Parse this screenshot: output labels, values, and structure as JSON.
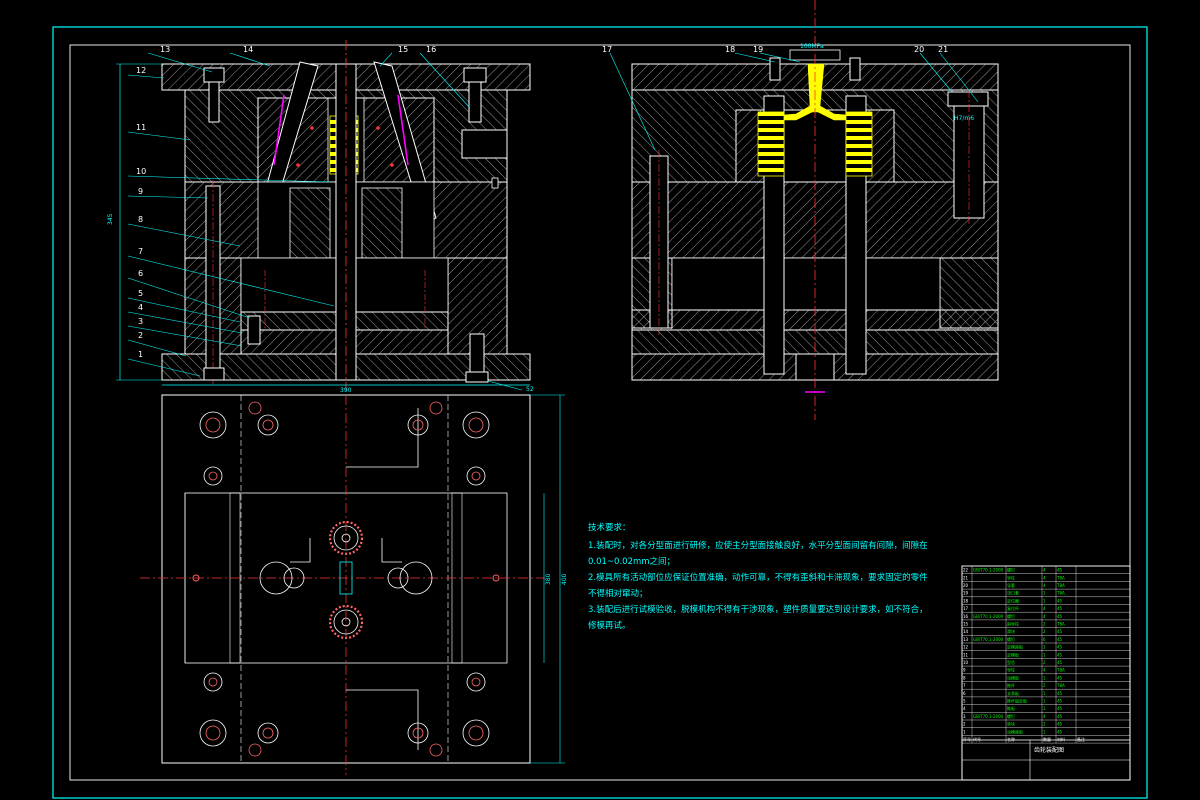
{
  "colors": {
    "background": "#000000",
    "frame": "#00ffff",
    "outline": "#ffffff",
    "hatch": "#bfbfbf",
    "centerline": "#ff3333",
    "spring": "#ffff00",
    "magenta": "#ff00ff"
  },
  "drawing": {
    "part_callouts_left": [
      "13",
      "14",
      "15",
      "16",
      "12",
      "11",
      "10",
      "9",
      "8",
      "7",
      "6",
      "5",
      "4",
      "3",
      "2",
      "1"
    ],
    "part_callouts_right": [
      "17",
      "18",
      "19",
      "20",
      "21"
    ],
    "dimensions": {
      "height_left": "345",
      "width_bottom": "390",
      "plan_height_outer": "400",
      "plan_height_inner": "380",
      "screw_label": "52",
      "flow_note_top": "100MPa",
      "flow_note_side": "H7/m6"
    }
  },
  "technical_requirements": {
    "title": "技术要求：",
    "lines": [
      "1.装配时，对各分型面进行研修，应使主分型面接触良好，水平分型面间留有间隙，间隙在",
      "0.01~0.02mm之间；",
      "2.模具所有活动部位应保证位置准确，动作可靠，不得有歪斜和卡滞现象，要求固定的零件",
      "不得相对窜动；",
      "3.装配后进行试模验收，脱模机构不得有干涉现象，塑件质量要达到设计要求，如不符合，",
      "修模再试。"
    ]
  },
  "title_block": {
    "drawing_title": "齿轮装配图",
    "header": [
      "序号",
      "代号",
      "名称",
      "数量",
      "材料",
      "备注"
    ],
    "rows": [
      [
        "22",
        "GB/T70.1-2000",
        "螺钉",
        "4",
        "45",
        ""
      ],
      [
        "21",
        "",
        "导柱",
        "4",
        "T8A",
        ""
      ],
      [
        "20",
        "",
        "导套",
        "4",
        "T8A",
        ""
      ],
      [
        "19",
        "",
        "浇口套",
        "1",
        "T8A",
        ""
      ],
      [
        "18",
        "",
        "定位圈",
        "1",
        "45",
        ""
      ],
      [
        "17",
        "",
        "复位杆",
        "4",
        "45",
        ""
      ],
      [
        "16",
        "GB/T70.1-2000",
        "螺钉",
        "4",
        "45",
        ""
      ],
      [
        "15",
        "",
        "斜导柱",
        "2",
        "T8A",
        ""
      ],
      [
        "14",
        "",
        "滑块",
        "2",
        "45",
        ""
      ],
      [
        "13",
        "GB/T70.1-2000",
        "螺钉",
        "6",
        "45",
        ""
      ],
      [
        "12",
        "",
        "定模座板",
        "1",
        "45",
        ""
      ],
      [
        "11",
        "",
        "定模板",
        "1",
        "45",
        ""
      ],
      [
        "10",
        "",
        "型芯",
        "2",
        "45",
        ""
      ],
      [
        "9",
        "",
        "导柱",
        "4",
        "T8A",
        ""
      ],
      [
        "8",
        "",
        "动模板",
        "1",
        "45",
        ""
      ],
      [
        "7",
        "",
        "推杆",
        "2",
        "T8A",
        ""
      ],
      [
        "6",
        "",
        "支承板",
        "1",
        "45",
        ""
      ],
      [
        "5",
        "",
        "推杆固定板",
        "1",
        "45",
        ""
      ],
      [
        "4",
        "",
        "推板",
        "1",
        "45",
        ""
      ],
      [
        "3",
        "GB/T70.1-2000",
        "螺钉",
        "4",
        "45",
        ""
      ],
      [
        "2",
        "",
        "垫块",
        "2",
        "45",
        ""
      ],
      [
        "1",
        "",
        "动模座板",
        "1",
        "45",
        ""
      ]
    ]
  }
}
